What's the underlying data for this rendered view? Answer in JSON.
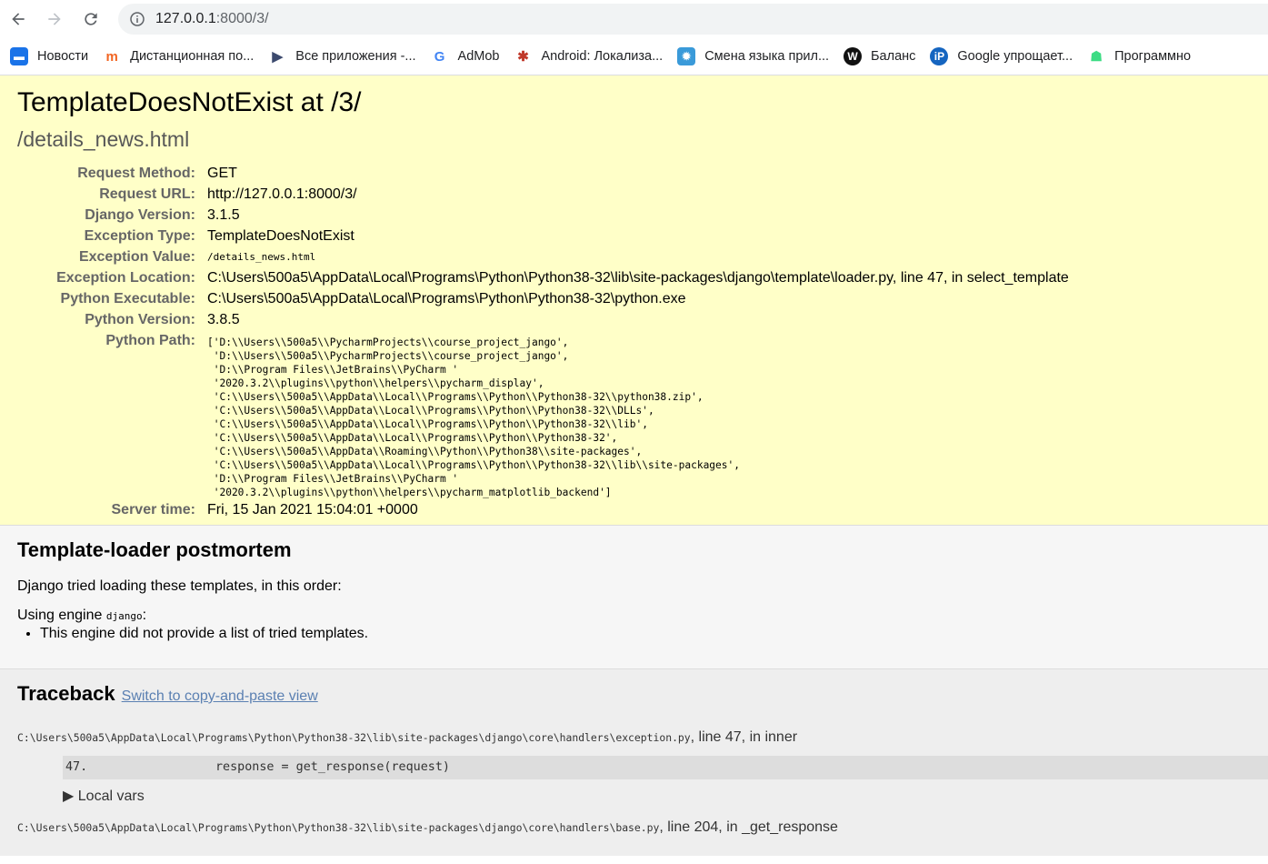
{
  "browser": {
    "url_host": "127.0.0.1",
    "url_path": ":8000/3/",
    "bookmarks": [
      {
        "label": "Новости",
        "icon": "chat-bubble-icon",
        "color": "#1a73e8"
      },
      {
        "label": "Дистанционная по...",
        "icon": "m-logo-icon",
        "color": "#f26522"
      },
      {
        "label": "Все приложения -...",
        "icon": "play-arrow-icon",
        "color": "#3c4a6e"
      },
      {
        "label": "AdMob",
        "icon": "google-g-icon",
        "color": "#4285f4"
      },
      {
        "label": "Android: Локализа...",
        "icon": "paw-icon",
        "color": "#c0392b"
      },
      {
        "label": "Смена языка прил...",
        "icon": "gear-blue-icon",
        "color": "#3a9ad9"
      },
      {
        "label": "Баланс",
        "icon": "w-logo-icon",
        "color": "#111111"
      },
      {
        "label": "Google упрощает...",
        "icon": "ip-logo-icon",
        "color": "#1565c0"
      },
      {
        "label": "Программно",
        "icon": "android-icon",
        "color": "#3ddc84"
      }
    ]
  },
  "error": {
    "title": "TemplateDoesNotExist at /3/",
    "subtitle": "/details_news.html",
    "meta": [
      {
        "label": "Request Method:",
        "value": "GET"
      },
      {
        "label": "Request URL:",
        "value": "http://127.0.0.1:8000/3/"
      },
      {
        "label": "Django Version:",
        "value": "3.1.5"
      },
      {
        "label": "Exception Type:",
        "value": "TemplateDoesNotExist"
      },
      {
        "label": "Exception Value:",
        "value": "/details_news.html"
      },
      {
        "label": "Exception Location:",
        "value": "C:\\Users\\500a5\\AppData\\Local\\Programs\\Python\\Python38-32\\lib\\site-packages\\django\\template\\loader.py, line 47, in select_template"
      },
      {
        "label": "Python Executable:",
        "value": "C:\\Users\\500a5\\AppData\\Local\\Programs\\Python\\Python38-32\\python.exe"
      },
      {
        "label": "Python Version:",
        "value": "3.8.5"
      },
      {
        "label": "Python Path:",
        "value": "['D:\\\\Users\\\\500a5\\\\PycharmProjects\\\\course_project_jango',\n 'D:\\\\Users\\\\500a5\\\\PycharmProjects\\\\course_project_jango',\n 'D:\\\\Program Files\\\\JetBrains\\\\PyCharm '\n '2020.3.2\\\\plugins\\\\python\\\\helpers\\\\pycharm_display',\n 'C:\\\\Users\\\\500a5\\\\AppData\\\\Local\\\\Programs\\\\Python\\\\Python38-32\\\\python38.zip',\n 'C:\\\\Users\\\\500a5\\\\AppData\\\\Local\\\\Programs\\\\Python\\\\Python38-32\\\\DLLs',\n 'C:\\\\Users\\\\500a5\\\\AppData\\\\Local\\\\Programs\\\\Python\\\\Python38-32\\\\lib',\n 'C:\\\\Users\\\\500a5\\\\AppData\\\\Local\\\\Programs\\\\Python\\\\Python38-32',\n 'C:\\\\Users\\\\500a5\\\\AppData\\\\Roaming\\\\Python\\\\Python38\\\\site-packages',\n 'C:\\\\Users\\\\500a5\\\\AppData\\\\Local\\\\Programs\\\\Python\\\\Python38-32\\\\lib\\\\site-packages',\n 'D:\\\\Program Files\\\\JetBrains\\\\PyCharm '\n '2020.3.2\\\\plugins\\\\python\\\\helpers\\\\pycharm_matplotlib_backend']"
      },
      {
        "label": "Server time:",
        "value": "Fri, 15 Jan 2021 15:04:01 +0000"
      }
    ]
  },
  "postmortem": {
    "heading": "Template-loader postmortem",
    "intro": "Django tried loading these templates, in this order:",
    "engine_prefix": "Using engine ",
    "engine_name": "django",
    "engine_suffix": ":",
    "item": "This engine did not provide a list of tried templates."
  },
  "traceback": {
    "heading": "Traceback",
    "switch_link": "Switch to copy-and-paste view",
    "frame1_file": "C:\\Users\\500a5\\AppData\\Local\\Programs\\Python\\Python38-32\\lib\\site-packages\\django\\core\\handlers\\exception.py",
    "frame1_loc": ", line 47, in inner",
    "frame1_lineno": "47.",
    "frame1_code": "response = get_response(request)",
    "local_vars": "Local vars",
    "frame2_file": "C:\\Users\\500a5\\AppData\\Local\\Programs\\Python\\Python38-32\\lib\\site-packages\\django\\core\\handlers\\base.py",
    "frame2_loc": ", line 204, in _get_response"
  }
}
